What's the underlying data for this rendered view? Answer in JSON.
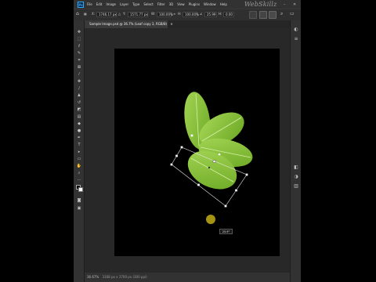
{
  "app": {
    "logo": "Ps"
  },
  "menu": [
    "File",
    "Edit",
    "Image",
    "Layer",
    "Type",
    "Select",
    "Filter",
    "3D",
    "View",
    "Plugins",
    "Window",
    "Help"
  ],
  "watermark": "WebSkillz",
  "window_controls": {
    "minimize": "–",
    "close": "✕"
  },
  "options_bar": {
    "x_value": "1746.17 px",
    "y_value": "1571.77 px",
    "width_value": "100.00%",
    "height_value": "100.00%",
    "angle_value": "25.99",
    "h_skew": "0.00"
  },
  "document_tab": {
    "title": "Sample Image.psd @ 36.7% (Leaf copy 3, RGB/8)",
    "close": "×"
  },
  "status_bar": {
    "zoom": "36.67%",
    "doc_size": "3168 px x 3700 px (300 ppi)"
  },
  "rotation_tooltip": "25.9°",
  "colors": {
    "leaf": "#8cc63f",
    "leaf_dark": "#5e9a1a",
    "yellow_dot": "#a39412"
  },
  "icons": [
    "move-icon",
    "marquee-icon",
    "lasso-icon",
    "quick-select-icon",
    "crop-icon",
    "frame-icon",
    "eyedropper-icon",
    "healing-icon",
    "brush-icon",
    "stamp-icon",
    "history-brush-icon",
    "eraser-icon",
    "gradient-icon",
    "blur-icon",
    "dodge-icon",
    "pen-icon",
    "type-icon",
    "path-select-icon",
    "rectangle-icon",
    "hand-icon",
    "zoom-icon",
    "more-icon",
    "color-swatch-icon",
    "quick-mask-icon",
    "screen-mode-icon"
  ]
}
